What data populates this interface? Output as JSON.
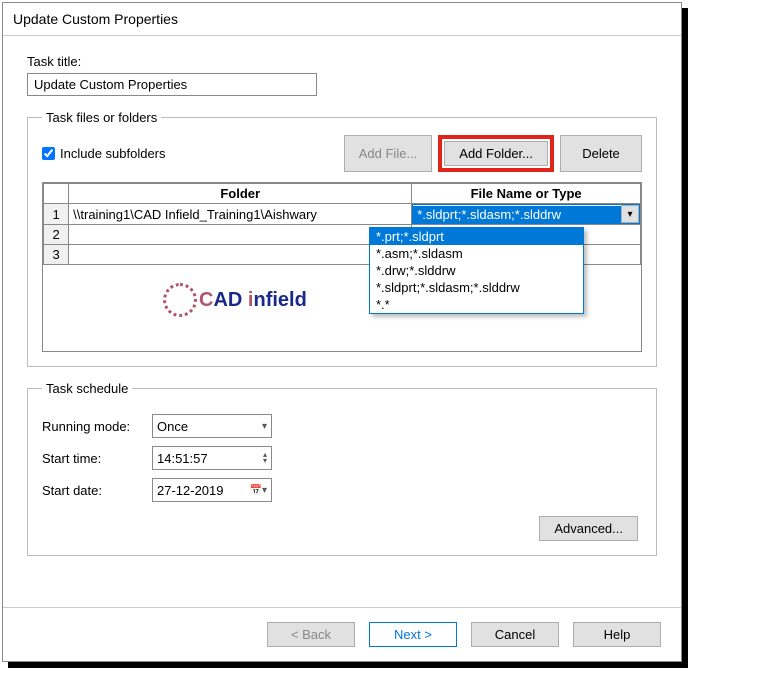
{
  "title": "Update Custom Properties",
  "taskTitleLabel": "Task title:",
  "taskTitleValue": "Update Custom Properties",
  "filesGroup": {
    "legend": "Task files or folders",
    "includeSubfolders": "Include subfolders",
    "buttons": {
      "addFile": "Add File...",
      "addFolder": "Add Folder...",
      "delete": "Delete"
    },
    "headers": {
      "folder": "Folder",
      "type": "File Name or Type"
    },
    "rows": [
      {
        "n": "1",
        "folder": "\\\\training1\\CAD Infield_Training1\\Aishwary",
        "type": "*.sldprt;*.sldasm;*.slddrw"
      },
      {
        "n": "2",
        "folder": "",
        "type": ""
      },
      {
        "n": "3",
        "folder": "",
        "type": ""
      }
    ],
    "dropdown": [
      "*.prt;*.sldprt",
      "*.asm;*.sldasm",
      "*.drw;*.slddrw",
      "*.sldprt;*.sldasm;*.slddrw",
      "*.*"
    ]
  },
  "schedule": {
    "legend": "Task schedule",
    "mode": {
      "label": "Running mode:",
      "value": "Once"
    },
    "time": {
      "label": "Start time:",
      "value": "14:51:57"
    },
    "date": {
      "label": "Start date:",
      "value": "27-12-2019"
    },
    "advanced": "Advanced..."
  },
  "footer": {
    "back": "< Back",
    "next": "Next >",
    "cancel": "Cancel",
    "help": "Help"
  },
  "watermark": {
    "c": "C",
    "a": "A",
    "d": "D",
    "i": "i",
    "rest": "nfield"
  }
}
